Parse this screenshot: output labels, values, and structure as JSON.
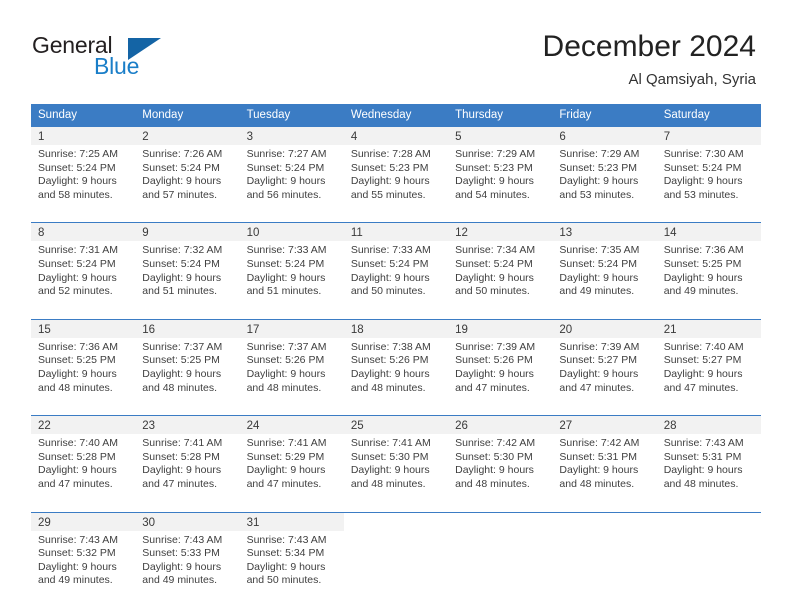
{
  "brand": {
    "word_one": "General",
    "word_two": "Blue"
  },
  "header": {
    "title": "December 2024",
    "subtitle": "Al Qamsiyah, Syria"
  },
  "colors": {
    "header_blue": "#3b7cc4",
    "logo_blue": "#1a7ec8",
    "logo_triangle": "#1464a5",
    "daynum_strip": "#f2f2f2",
    "text": "#3f3f3f"
  },
  "weekdays": [
    "Sunday",
    "Monday",
    "Tuesday",
    "Wednesday",
    "Thursday",
    "Friday",
    "Saturday"
  ],
  "weeks": [
    [
      {
        "day": "1",
        "sunrise": "Sunrise: 7:25 AM",
        "sunset": "Sunset: 5:24 PM",
        "daylight_1": "Daylight: 9 hours",
        "daylight_2": "and 58 minutes."
      },
      {
        "day": "2",
        "sunrise": "Sunrise: 7:26 AM",
        "sunset": "Sunset: 5:24 PM",
        "daylight_1": "Daylight: 9 hours",
        "daylight_2": "and 57 minutes."
      },
      {
        "day": "3",
        "sunrise": "Sunrise: 7:27 AM",
        "sunset": "Sunset: 5:24 PM",
        "daylight_1": "Daylight: 9 hours",
        "daylight_2": "and 56 minutes."
      },
      {
        "day": "4",
        "sunrise": "Sunrise: 7:28 AM",
        "sunset": "Sunset: 5:23 PM",
        "daylight_1": "Daylight: 9 hours",
        "daylight_2": "and 55 minutes."
      },
      {
        "day": "5",
        "sunrise": "Sunrise: 7:29 AM",
        "sunset": "Sunset: 5:23 PM",
        "daylight_1": "Daylight: 9 hours",
        "daylight_2": "and 54 minutes."
      },
      {
        "day": "6",
        "sunrise": "Sunrise: 7:29 AM",
        "sunset": "Sunset: 5:23 PM",
        "daylight_1": "Daylight: 9 hours",
        "daylight_2": "and 53 minutes."
      },
      {
        "day": "7",
        "sunrise": "Sunrise: 7:30 AM",
        "sunset": "Sunset: 5:24 PM",
        "daylight_1": "Daylight: 9 hours",
        "daylight_2": "and 53 minutes."
      }
    ],
    [
      {
        "day": "8",
        "sunrise": "Sunrise: 7:31 AM",
        "sunset": "Sunset: 5:24 PM",
        "daylight_1": "Daylight: 9 hours",
        "daylight_2": "and 52 minutes."
      },
      {
        "day": "9",
        "sunrise": "Sunrise: 7:32 AM",
        "sunset": "Sunset: 5:24 PM",
        "daylight_1": "Daylight: 9 hours",
        "daylight_2": "and 51 minutes."
      },
      {
        "day": "10",
        "sunrise": "Sunrise: 7:33 AM",
        "sunset": "Sunset: 5:24 PM",
        "daylight_1": "Daylight: 9 hours",
        "daylight_2": "and 51 minutes."
      },
      {
        "day": "11",
        "sunrise": "Sunrise: 7:33 AM",
        "sunset": "Sunset: 5:24 PM",
        "daylight_1": "Daylight: 9 hours",
        "daylight_2": "and 50 minutes."
      },
      {
        "day": "12",
        "sunrise": "Sunrise: 7:34 AM",
        "sunset": "Sunset: 5:24 PM",
        "daylight_1": "Daylight: 9 hours",
        "daylight_2": "and 50 minutes."
      },
      {
        "day": "13",
        "sunrise": "Sunrise: 7:35 AM",
        "sunset": "Sunset: 5:24 PM",
        "daylight_1": "Daylight: 9 hours",
        "daylight_2": "and 49 minutes."
      },
      {
        "day": "14",
        "sunrise": "Sunrise: 7:36 AM",
        "sunset": "Sunset: 5:25 PM",
        "daylight_1": "Daylight: 9 hours",
        "daylight_2": "and 49 minutes."
      }
    ],
    [
      {
        "day": "15",
        "sunrise": "Sunrise: 7:36 AM",
        "sunset": "Sunset: 5:25 PM",
        "daylight_1": "Daylight: 9 hours",
        "daylight_2": "and 48 minutes."
      },
      {
        "day": "16",
        "sunrise": "Sunrise: 7:37 AM",
        "sunset": "Sunset: 5:25 PM",
        "daylight_1": "Daylight: 9 hours",
        "daylight_2": "and 48 minutes."
      },
      {
        "day": "17",
        "sunrise": "Sunrise: 7:37 AM",
        "sunset": "Sunset: 5:26 PM",
        "daylight_1": "Daylight: 9 hours",
        "daylight_2": "and 48 minutes."
      },
      {
        "day": "18",
        "sunrise": "Sunrise: 7:38 AM",
        "sunset": "Sunset: 5:26 PM",
        "daylight_1": "Daylight: 9 hours",
        "daylight_2": "and 48 minutes."
      },
      {
        "day": "19",
        "sunrise": "Sunrise: 7:39 AM",
        "sunset": "Sunset: 5:26 PM",
        "daylight_1": "Daylight: 9 hours",
        "daylight_2": "and 47 minutes."
      },
      {
        "day": "20",
        "sunrise": "Sunrise: 7:39 AM",
        "sunset": "Sunset: 5:27 PM",
        "daylight_1": "Daylight: 9 hours",
        "daylight_2": "and 47 minutes."
      },
      {
        "day": "21",
        "sunrise": "Sunrise: 7:40 AM",
        "sunset": "Sunset: 5:27 PM",
        "daylight_1": "Daylight: 9 hours",
        "daylight_2": "and 47 minutes."
      }
    ],
    [
      {
        "day": "22",
        "sunrise": "Sunrise: 7:40 AM",
        "sunset": "Sunset: 5:28 PM",
        "daylight_1": "Daylight: 9 hours",
        "daylight_2": "and 47 minutes."
      },
      {
        "day": "23",
        "sunrise": "Sunrise: 7:41 AM",
        "sunset": "Sunset: 5:28 PM",
        "daylight_1": "Daylight: 9 hours",
        "daylight_2": "and 47 minutes."
      },
      {
        "day": "24",
        "sunrise": "Sunrise: 7:41 AM",
        "sunset": "Sunset: 5:29 PM",
        "daylight_1": "Daylight: 9 hours",
        "daylight_2": "and 47 minutes."
      },
      {
        "day": "25",
        "sunrise": "Sunrise: 7:41 AM",
        "sunset": "Sunset: 5:30 PM",
        "daylight_1": "Daylight: 9 hours",
        "daylight_2": "and 48 minutes."
      },
      {
        "day": "26",
        "sunrise": "Sunrise: 7:42 AM",
        "sunset": "Sunset: 5:30 PM",
        "daylight_1": "Daylight: 9 hours",
        "daylight_2": "and 48 minutes."
      },
      {
        "day": "27",
        "sunrise": "Sunrise: 7:42 AM",
        "sunset": "Sunset: 5:31 PM",
        "daylight_1": "Daylight: 9 hours",
        "daylight_2": "and 48 minutes."
      },
      {
        "day": "28",
        "sunrise": "Sunrise: 7:43 AM",
        "sunset": "Sunset: 5:31 PM",
        "daylight_1": "Daylight: 9 hours",
        "daylight_2": "and 48 minutes."
      }
    ],
    [
      {
        "day": "29",
        "sunrise": "Sunrise: 7:43 AM",
        "sunset": "Sunset: 5:32 PM",
        "daylight_1": "Daylight: 9 hours",
        "daylight_2": "and 49 minutes."
      },
      {
        "day": "30",
        "sunrise": "Sunrise: 7:43 AM",
        "sunset": "Sunset: 5:33 PM",
        "daylight_1": "Daylight: 9 hours",
        "daylight_2": "and 49 minutes."
      },
      {
        "day": "31",
        "sunrise": "Sunrise: 7:43 AM",
        "sunset": "Sunset: 5:34 PM",
        "daylight_1": "Daylight: 9 hours",
        "daylight_2": "and 50 minutes."
      },
      {
        "day": "",
        "sunrise": "",
        "sunset": "",
        "daylight_1": "",
        "daylight_2": ""
      },
      {
        "day": "",
        "sunrise": "",
        "sunset": "",
        "daylight_1": "",
        "daylight_2": ""
      },
      {
        "day": "",
        "sunrise": "",
        "sunset": "",
        "daylight_1": "",
        "daylight_2": ""
      },
      {
        "day": "",
        "sunrise": "",
        "sunset": "",
        "daylight_1": "",
        "daylight_2": ""
      }
    ]
  ]
}
